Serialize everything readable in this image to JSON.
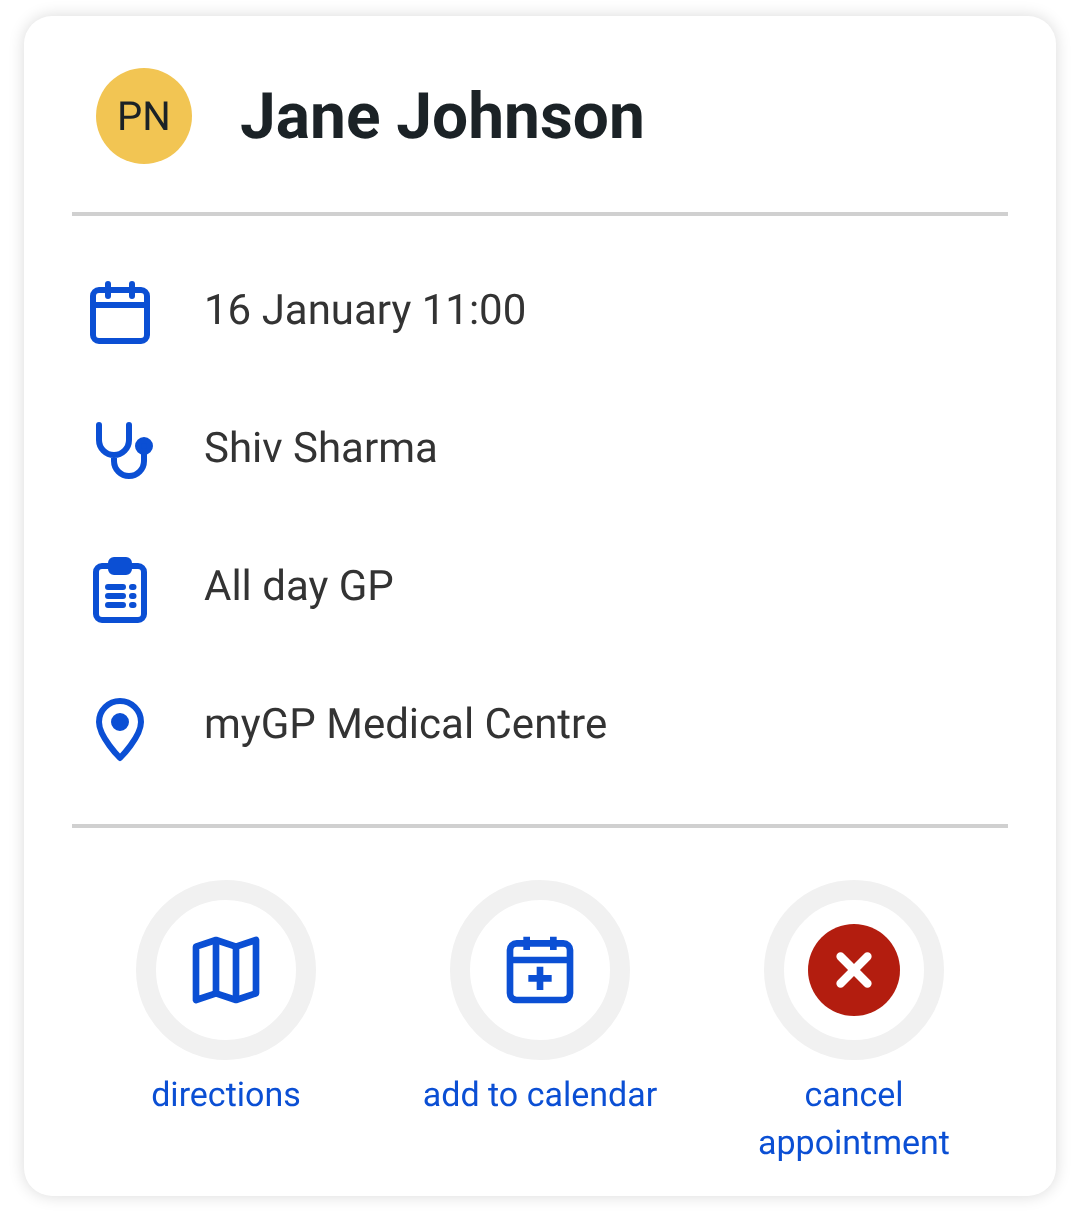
{
  "header": {
    "initials": "PN",
    "name": "Jane Johnson"
  },
  "details": [
    {
      "kind": "date",
      "text": "16 January 11:00"
    },
    {
      "kind": "clinician",
      "text": "Shiv Sharma"
    },
    {
      "kind": "service",
      "text": "All day GP"
    },
    {
      "kind": "location",
      "text": "myGP Medical Centre"
    }
  ],
  "actions": [
    {
      "kind": "directions",
      "label": "directions"
    },
    {
      "kind": "calendar",
      "label": "add to calendar"
    },
    {
      "kind": "cancel",
      "label": "cancel appointment"
    }
  ]
}
